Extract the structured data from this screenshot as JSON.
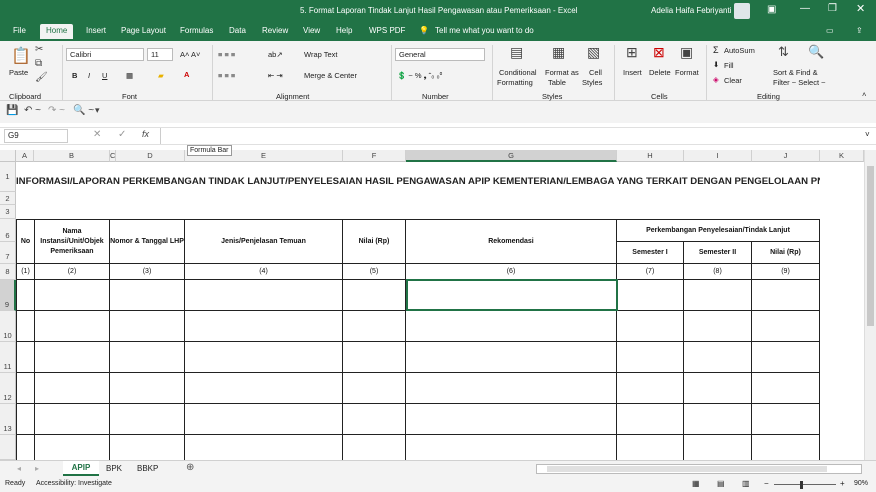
{
  "window": {
    "title": "5. Format Laporan Tindak Lanjut Hasil Pengawasan atau Pemeriksaan  -  Excel",
    "user": "Adelia Haifa Febriyanti"
  },
  "tabs": [
    "File",
    "Home",
    "Insert",
    "Page Layout",
    "Formulas",
    "Data",
    "Review",
    "View",
    "Help",
    "WPS PDF"
  ],
  "tell_me": "Tell me what you want to do",
  "ribbon": {
    "paste": "Paste",
    "clipboard": "Clipboard",
    "font_name": "Calibri",
    "font_size": "11",
    "font_group": "Font",
    "wrap": "Wrap Text",
    "merge": "Merge & Center",
    "alignment": "Alignment",
    "number_format": "General",
    "number": "Number",
    "cond": "Conditional",
    "cond2": "Formatting",
    "fmt_table": "Format as",
    "fmt_table2": "Table",
    "cell_styles": "Cell",
    "cell_styles2": "Styles",
    "styles": "Styles",
    "insert": "Insert",
    "delete": "Delete",
    "format": "Format",
    "cells": "Cells",
    "autosum": "AutoSum",
    "fill": "Fill",
    "clear": "Clear",
    "sort": "Sort & Find &",
    "sort2": "Filter ~ Select ~",
    "editing": "Editing"
  },
  "name_box": "G9",
  "formula_tooltip": "Formula Bar",
  "columns": [
    "A",
    "B",
    "C",
    "D",
    "E",
    "F",
    "G",
    "H",
    "I",
    "J",
    "K"
  ],
  "rows": [
    "1",
    "2",
    "3",
    "6",
    "7",
    "8",
    "9",
    "10",
    "11",
    "12",
    "13"
  ],
  "sheet": {
    "title": "INFORMASI/LAPORAN PERKEMBANGAN TINDAK LANJUT/PENYELESAIAN HASIL PENGAWASAN APIP KEMENTERIAN/LEMBAGA YANG TERKAIT DENGAN PENGELOLAAN PNBP",
    "h_no": "No",
    "h_nama": "Nama Instansi/Unit/Objek Pemeriksaan",
    "h_nomor": "Nomor & Tanggal LHP",
    "h_jenis": "Jenis/Penjelasan Temuan",
    "h_nilai": "Nilai (Rp)",
    "h_rek": "Rekomendasi",
    "h_perk": "Perkembangan Penyelesaian/Tindak Lanjut",
    "h_s1": "Semester I",
    "h_s2": "Semester II",
    "h_nilai2": "Nilai (Rp)",
    "idx": [
      "(1)",
      "(2)",
      "(3)",
      "(4)",
      "(5)",
      "(6)",
      "(7)",
      "(8)",
      "(9)"
    ]
  },
  "sheet_tabs": [
    "APIP",
    "BPK",
    "BBKP"
  ],
  "status": {
    "ready": "Ready",
    "access": "Accessibility: Investigate",
    "zoom": "90%"
  }
}
